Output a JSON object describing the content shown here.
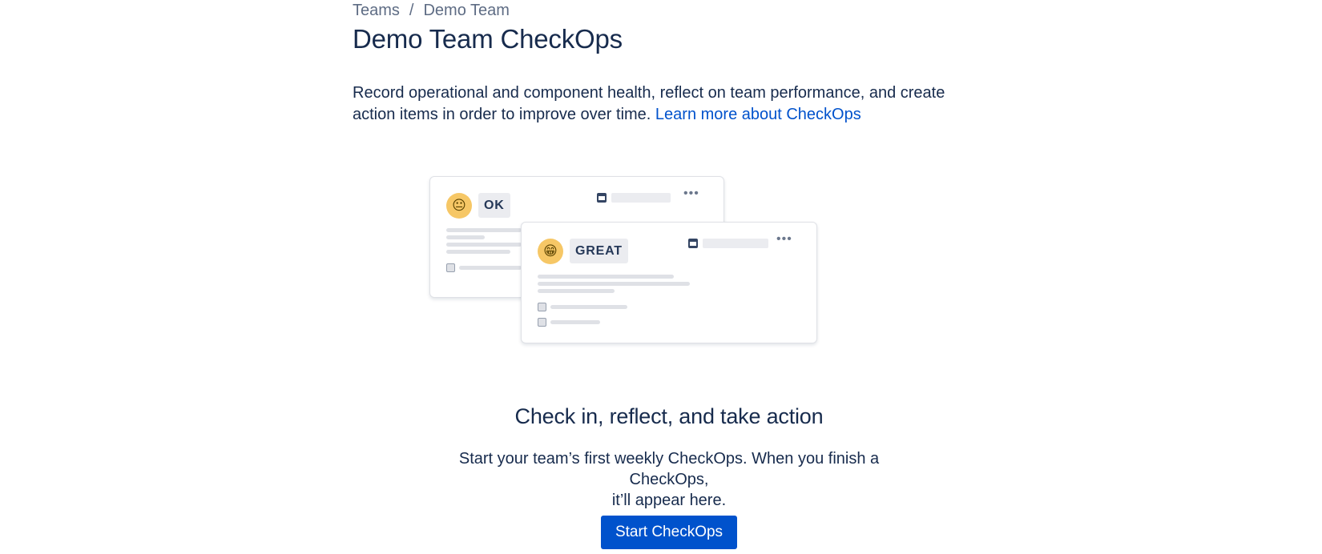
{
  "breadcrumb": {
    "items": [
      "Teams",
      "Demo Team"
    ],
    "separator": "/"
  },
  "page": {
    "title": "Demo Team CheckOps"
  },
  "intro": {
    "text": "Record operational and component health, reflect on team performance, and create action items in order to improve over time. ",
    "link_label": "Learn more about CheckOps"
  },
  "illustration": {
    "back_card": {
      "emoji": "neutral-face-icon",
      "tag": "OK"
    },
    "front_card": {
      "emoji": "grinning-face-icon",
      "tag": "GREAT"
    }
  },
  "empty_state": {
    "title": "Check in, reflect, and take action",
    "body_line1": "Start your team’s first weekly CheckOps. When you finish a CheckOps,",
    "body_line2": "it’ll appear here."
  },
  "actions": {
    "start_label": "Start CheckOps"
  },
  "colors": {
    "primary": "#0052cc",
    "text": "#172b4d",
    "muted": "#5e6c84",
    "emoji": "#f6c766"
  }
}
